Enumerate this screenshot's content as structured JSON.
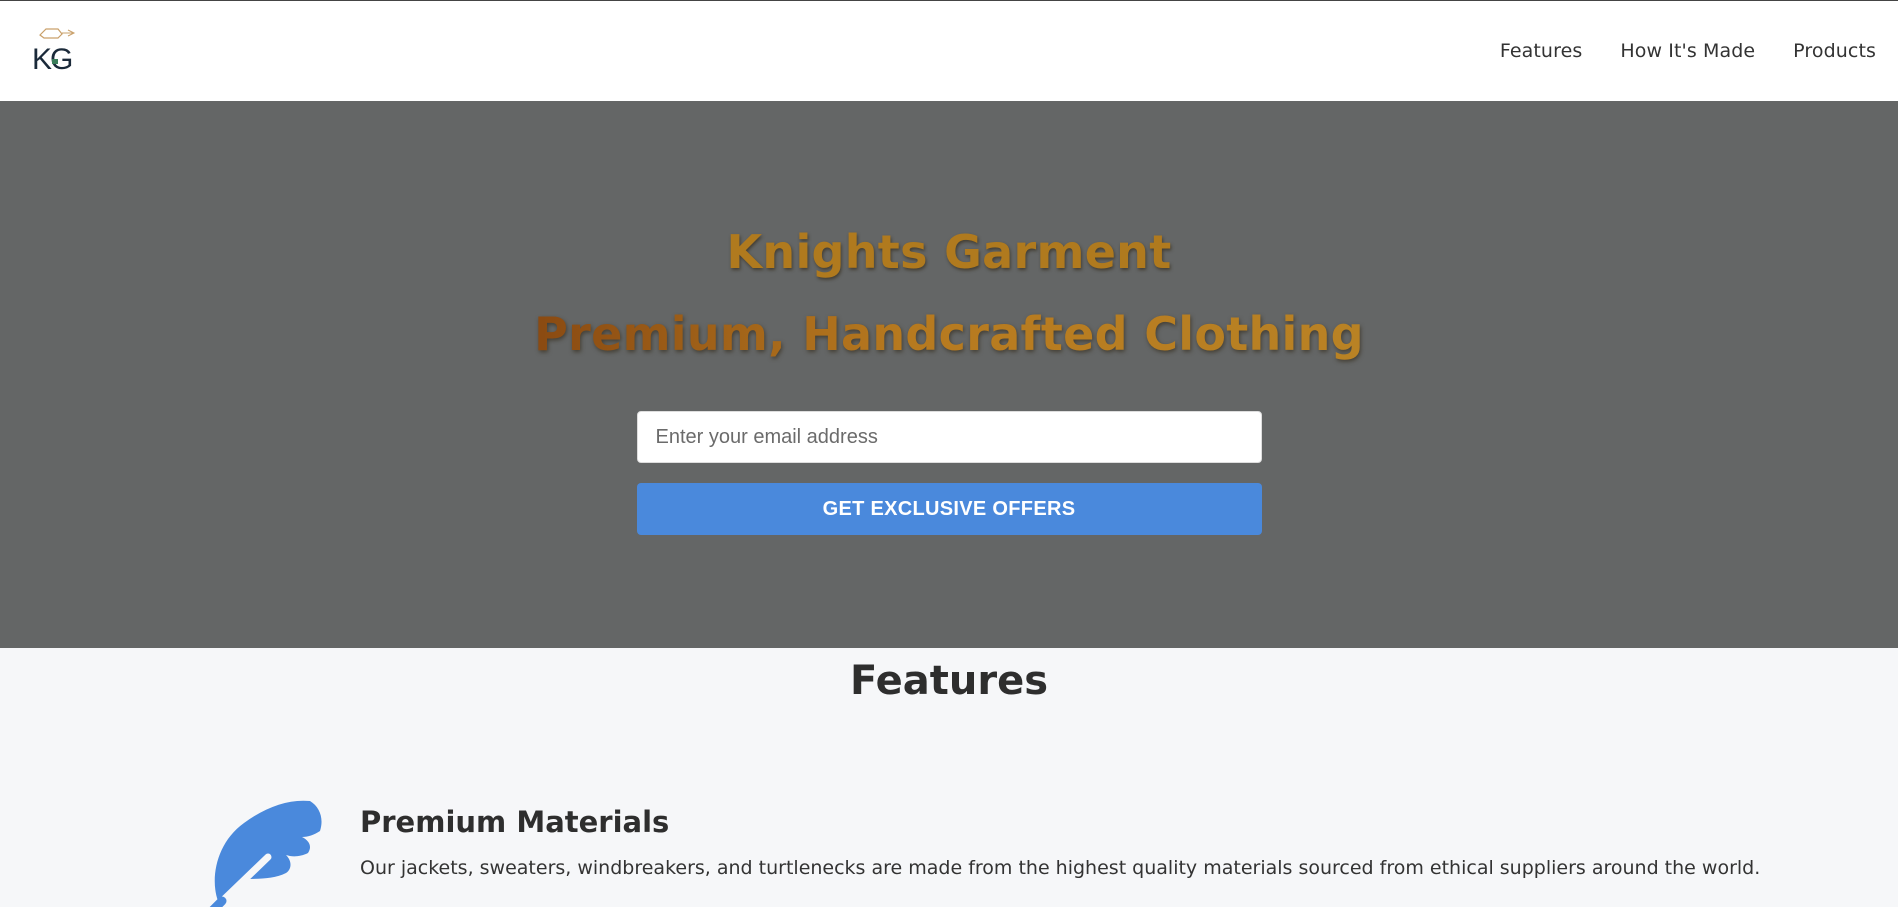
{
  "header": {
    "logo_text": "KG",
    "nav": [
      {
        "label": "Features"
      },
      {
        "label": "How It's Made"
      },
      {
        "label": "Products"
      }
    ]
  },
  "hero": {
    "title": "Knights Garment",
    "subtitle": "Premium, Handcrafted Clothing",
    "email_placeholder": "Enter your email address",
    "cta_label": "GET EXCLUSIVE OFFERS"
  },
  "features": {
    "title": "Features",
    "items": [
      {
        "icon": "feather-icon",
        "heading": "Premium Materials",
        "description": "Our jackets, sweaters, windbreakers, and turtlenecks are made from the highest quality materials sourced from ethical suppliers around the world."
      }
    ]
  },
  "colors": {
    "hero_bg": "#646666",
    "hero_title": "#b07a1e",
    "cta_bg": "#4a89dc",
    "icon": "#4a89dc"
  }
}
